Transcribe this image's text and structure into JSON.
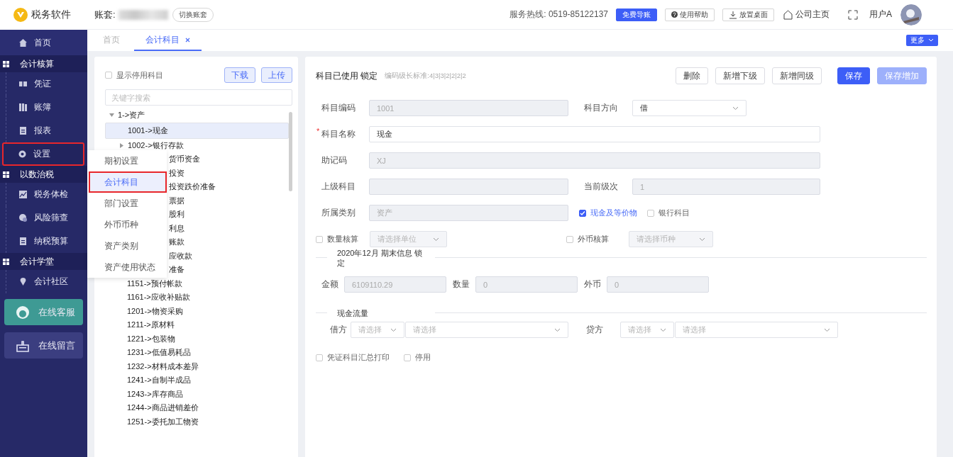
{
  "app": {
    "name": "税务软件"
  },
  "header": {
    "account_label": "账套:",
    "switch_button": "切换账套",
    "hotline": "服务热线:  0519-85122137",
    "buttons": [
      {
        "label": "免费导账",
        "kind": "primary"
      },
      {
        "label": "使用帮助",
        "kind": "help"
      },
      {
        "label": "放置桌面",
        "kind": "download"
      }
    ],
    "home_link": "公司主页",
    "user": "用户A"
  },
  "sidebar": {
    "items": [
      {
        "kind": "link",
        "label": "首页",
        "highlighted": false
      },
      {
        "kind": "group",
        "label": "会计核算",
        "highlighted": false
      },
      {
        "kind": "sub",
        "label": "凭证",
        "highlighted": false
      },
      {
        "kind": "sub",
        "label": "账簿",
        "highlighted": false
      },
      {
        "kind": "sub",
        "label": "报表",
        "highlighted": false
      },
      {
        "kind": "sub",
        "label": "设置",
        "highlighted": true
      },
      {
        "kind": "group",
        "label": "以数治税",
        "highlighted": false
      },
      {
        "kind": "sub",
        "label": "税务体检",
        "highlighted": false
      },
      {
        "kind": "sub",
        "label": "风险筛查",
        "highlighted": false
      },
      {
        "kind": "sub",
        "label": "纳税预算",
        "highlighted": false
      },
      {
        "kind": "group",
        "label": "会计学堂",
        "highlighted": false
      },
      {
        "kind": "sub",
        "label": "会计社区",
        "highlighted": false
      }
    ],
    "buttons": [
      {
        "label": "在线客服",
        "kind": "service"
      },
      {
        "label": "在线留言",
        "kind": "message"
      }
    ]
  },
  "submenu": [
    {
      "label": "期初设置",
      "selected": false,
      "highlighted": false
    },
    {
      "label": "会计科目",
      "selected": true,
      "highlighted": true
    },
    {
      "label": "部门设置",
      "selected": false,
      "highlighted": false
    },
    {
      "label": "外币币种",
      "selected": false,
      "highlighted": false
    },
    {
      "label": "资产类别",
      "selected": false,
      "highlighted": false
    },
    {
      "label": "资产使用状态",
      "selected": false,
      "highlighted": false
    }
  ],
  "tabs": [
    {
      "label": "首页",
      "selected": false,
      "closable": false
    },
    {
      "label": "会计科目",
      "selected": true,
      "closable": true
    }
  ],
  "more_button": "更多",
  "tree_panel": {
    "show_disabled": {
      "label": "显示停用科目",
      "checked": false
    },
    "buttons": [
      "下载",
      "上传"
    ],
    "search": {
      "placeholder": "关键字搜索"
    },
    "tree": [
      {
        "label": "1->资产",
        "expanded": true,
        "selected": false,
        "children": [
          {
            "label": "1001->现金",
            "kind": "leaf",
            "selected": true
          },
          {
            "label": "1002->银行存款",
            "kind": "folder",
            "expanded": false,
            "selected": false
          },
          {
            "label": "货币资金",
            "kind": "covered",
            "selected": false
          },
          {
            "label": "投资",
            "kind": "covered",
            "selected": false
          },
          {
            "label": "投资跌价准备",
            "kind": "covered",
            "selected": false
          },
          {
            "label": "票据",
            "kind": "covered",
            "selected": false
          },
          {
            "label": "股利",
            "kind": "covered",
            "selected": false
          },
          {
            "label": "利息",
            "kind": "covered",
            "selected": false
          },
          {
            "label": "账款",
            "kind": "covered",
            "selected": false
          },
          {
            "label": "应收款",
            "kind": "covered",
            "selected": false
          },
          {
            "label": "准备",
            "kind": "covered",
            "selected": false
          },
          {
            "label": "1151->预付帐款",
            "kind": "leaf",
            "selected": false
          },
          {
            "label": "1161->应收补贴款",
            "kind": "leaf",
            "selected": false
          },
          {
            "label": "1201->物资采购",
            "kind": "leaf",
            "selected": false
          },
          {
            "label": "1211->原材料",
            "kind": "leaf",
            "selected": false
          },
          {
            "label": "1221->包装物",
            "kind": "leaf",
            "selected": false
          },
          {
            "label": "1231->低值易耗品",
            "kind": "leaf",
            "selected": false
          },
          {
            "label": "1232->材料成本差异",
            "kind": "leaf",
            "selected": false
          },
          {
            "label": "1241->自制半成品",
            "kind": "leaf",
            "selected": false
          },
          {
            "label": "1243->库存商品",
            "kind": "leaf",
            "selected": false
          },
          {
            "label": "1244->商品进销差价",
            "kind": "leaf",
            "selected": false
          },
          {
            "label": "1251->委托加工物资",
            "kind": "leaf",
            "selected": false
          }
        ]
      }
    ]
  },
  "form": {
    "title": "科目已使用 锁定",
    "code_rule": "编码级长标准:4|3|3|2|2|2|2",
    "actions": [
      {
        "label": "删除",
        "kind": "plain",
        "disabled": false
      },
      {
        "label": "新增下级",
        "kind": "plain",
        "disabled": false
      },
      {
        "label": "新增同级",
        "kind": "plain",
        "disabled": false
      },
      {
        "label": "保存",
        "kind": "primary",
        "disabled": false
      },
      {
        "label": "保存增加",
        "kind": "primary",
        "disabled": true
      }
    ],
    "code": {
      "label": "科目编码",
      "value": "1001",
      "disabled": true
    },
    "direction": {
      "label": "科目方向",
      "value": "借"
    },
    "name": {
      "label": "科目名称",
      "value": "现金",
      "required_mark": "*"
    },
    "mnemonic": {
      "label": "助记码",
      "value": "XJ",
      "disabled": true
    },
    "parent": {
      "label": "上级科目",
      "disabled": true
    },
    "level": {
      "label": "当前级次",
      "value": "1",
      "disabled": true
    },
    "category": {
      "label": "所属类别",
      "value": "资产",
      "disabled": true
    },
    "flags": [
      {
        "label": "现金及等价物",
        "checked": true
      },
      {
        "label": "银行科目",
        "checked": false
      }
    ],
    "quantity": {
      "label": "数量核算",
      "checked": false,
      "placeholder": "请选择单位"
    },
    "currency": {
      "label": "外币核算",
      "checked": false,
      "placeholder": "请选择币种"
    },
    "period_section": "2020年12月 期末信息 锁定",
    "balances": [
      {
        "label": "金额",
        "value": "6109110.29"
      },
      {
        "label": "数量",
        "value": "0"
      },
      {
        "label": "外币",
        "value": "0"
      }
    ],
    "cashflow_section": "现金流量",
    "cashflow": [
      {
        "label": "借方",
        "type_placeholder": "请选择",
        "item_placeholder": "请选择"
      },
      {
        "label": "贷方",
        "type_placeholder": "请选择",
        "item_placeholder": "请选择"
      }
    ],
    "options": [
      {
        "label": "凭证科目汇总打印",
        "checked": false
      },
      {
        "label": "停用",
        "checked": false
      }
    ]
  }
}
